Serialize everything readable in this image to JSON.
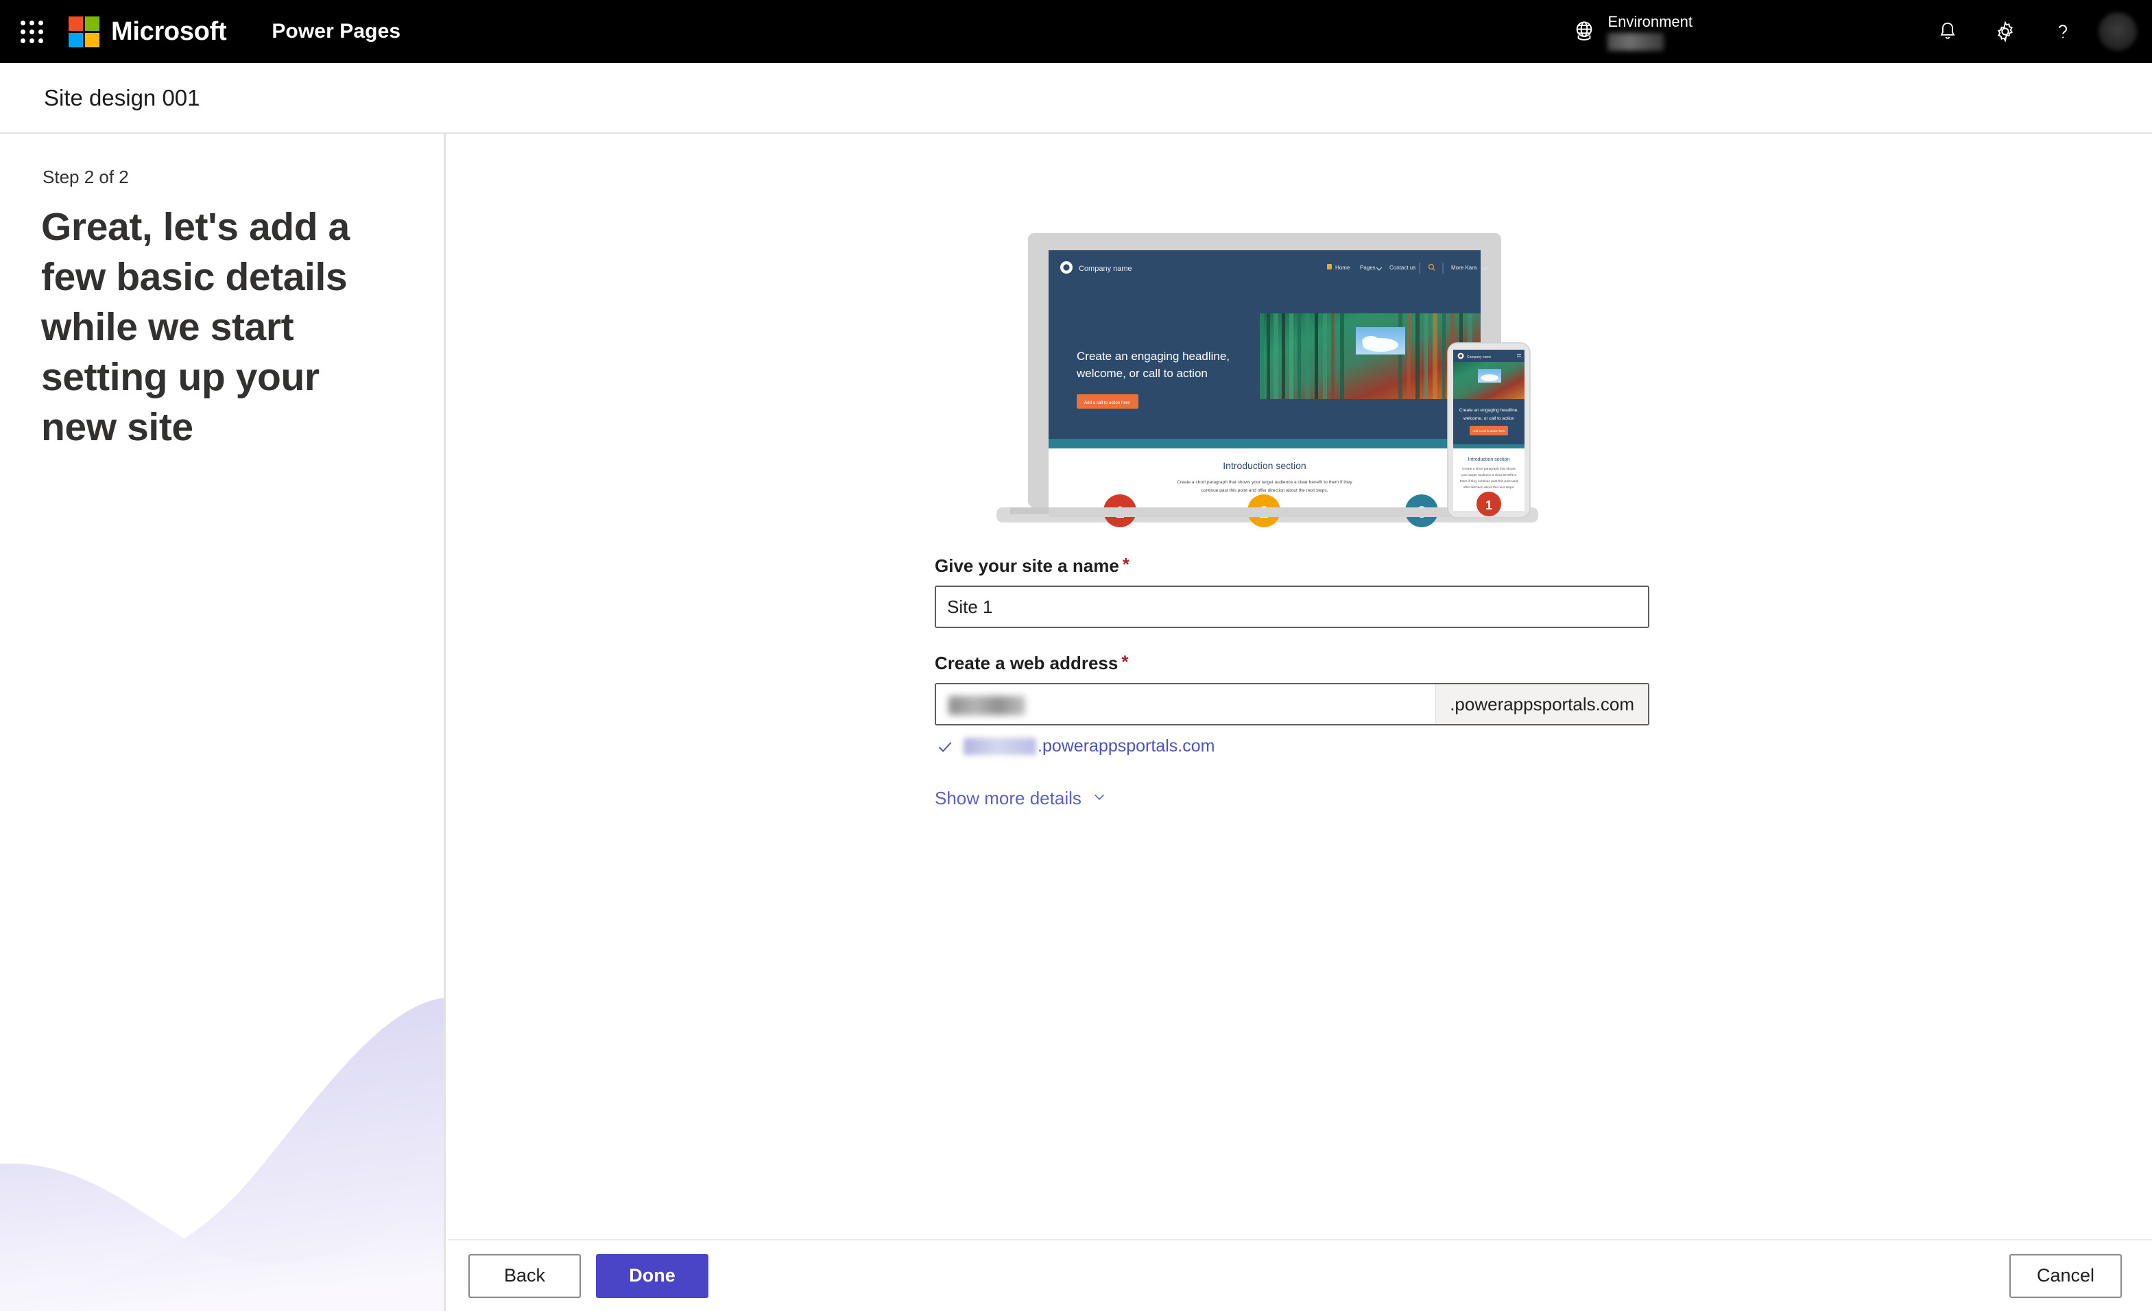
{
  "suite_bar": {
    "waffle_icon": "app-launcher-icon",
    "brand": "Microsoft",
    "app_name": "Power Pages",
    "environment_label": "Environment",
    "environment_value": "",
    "globe_icon": "globe-icon",
    "notifications_icon": "bell-icon",
    "settings_icon": "gear-icon",
    "help_icon": "question-mark-icon",
    "avatar": "user-avatar"
  },
  "sub_header": {
    "page_title": "Site design 001"
  },
  "left_panel": {
    "step_label": "Step 2 of 2",
    "heading": "Great, let's add a few basic details while we start setting up your new site"
  },
  "preview": {
    "company_name": "Company name",
    "nav_items": [
      "Home",
      "Pages",
      "Contact us"
    ],
    "search_icon": "search-icon",
    "account_name": "More Kara",
    "hero_headline": "Create an engaging headline, welcome, or call to action",
    "cta_label": "Add a call to action here",
    "intro_title": "Introduction section",
    "intro_body": "Create a short paragraph that shows your target audience a clear benefit to them if they continue past this point and offer direction about the next steps.",
    "step_badges": [
      "1",
      "2",
      "3"
    ],
    "mobile_step_badge": "1",
    "colors": {
      "hero_navy": "#2d4a6b",
      "teal_band": "#2a7f93",
      "cta_orange": "#e8713c",
      "badge_red": "#d13a27",
      "badge_orange": "#f5a300",
      "badge_teal": "#2a7e97"
    }
  },
  "form": {
    "site_name": {
      "label": "Give your site a name",
      "required_marker": "*",
      "value": "Site 1",
      "placeholder": "Site 1"
    },
    "web_address": {
      "label": "Create a web address",
      "required_marker": "*",
      "value": "",
      "suffix": ".powerappsportals.com",
      "validation_icon": "checkmark-icon",
      "validation_suffix": ".powerappsportals.com"
    },
    "show_more_details": {
      "label": "Show more details",
      "chevron_icon": "chevron-down-icon"
    }
  },
  "footer": {
    "back_label": "Back",
    "done_label": "Done",
    "cancel_label": "Cancel"
  },
  "colors": {
    "primary_button": "#4a44c6",
    "link": "#5b5fc7",
    "required_star": "#a4262c",
    "suite_bar_bg": "#000000"
  }
}
